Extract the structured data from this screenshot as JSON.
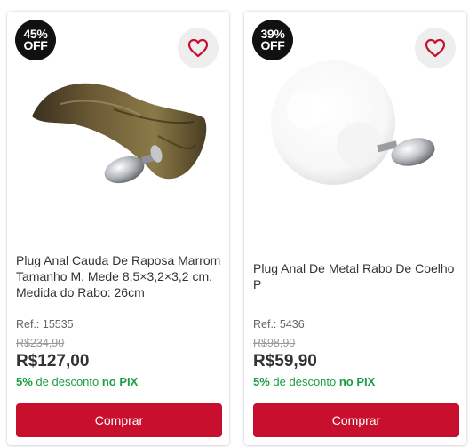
{
  "colors": {
    "accent": "#c8102e",
    "pix_green": "#1a9e46",
    "badge_bg": "#111111"
  },
  "products": [
    {
      "discount_line1": "45%",
      "discount_line2": "OFF",
      "favorite_icon": "heart-outline-icon",
      "title": "Plug Anal Cauda De Raposa Marrom Tamanho M. Mede 8,5×3,2×3,2 cm. Medida do Rabo: 26cm",
      "ref": "Ref.: 15535",
      "old_price": "R$234,90",
      "price": "R$127,00",
      "pix_percent": "5%",
      "pix_text": " de desconto ",
      "pix_label": "no PIX",
      "buy_label": "Comprar"
    },
    {
      "discount_line1": "39%",
      "discount_line2": "OFF",
      "favorite_icon": "heart-outline-icon",
      "title": "Plug Anal De Metal Rabo De Coelho P",
      "ref": "Ref.: 5436",
      "old_price": "R$98,90",
      "price": "R$59,90",
      "pix_percent": "5%",
      "pix_text": " de desconto ",
      "pix_label": "no PIX",
      "buy_label": "Comprar"
    }
  ]
}
